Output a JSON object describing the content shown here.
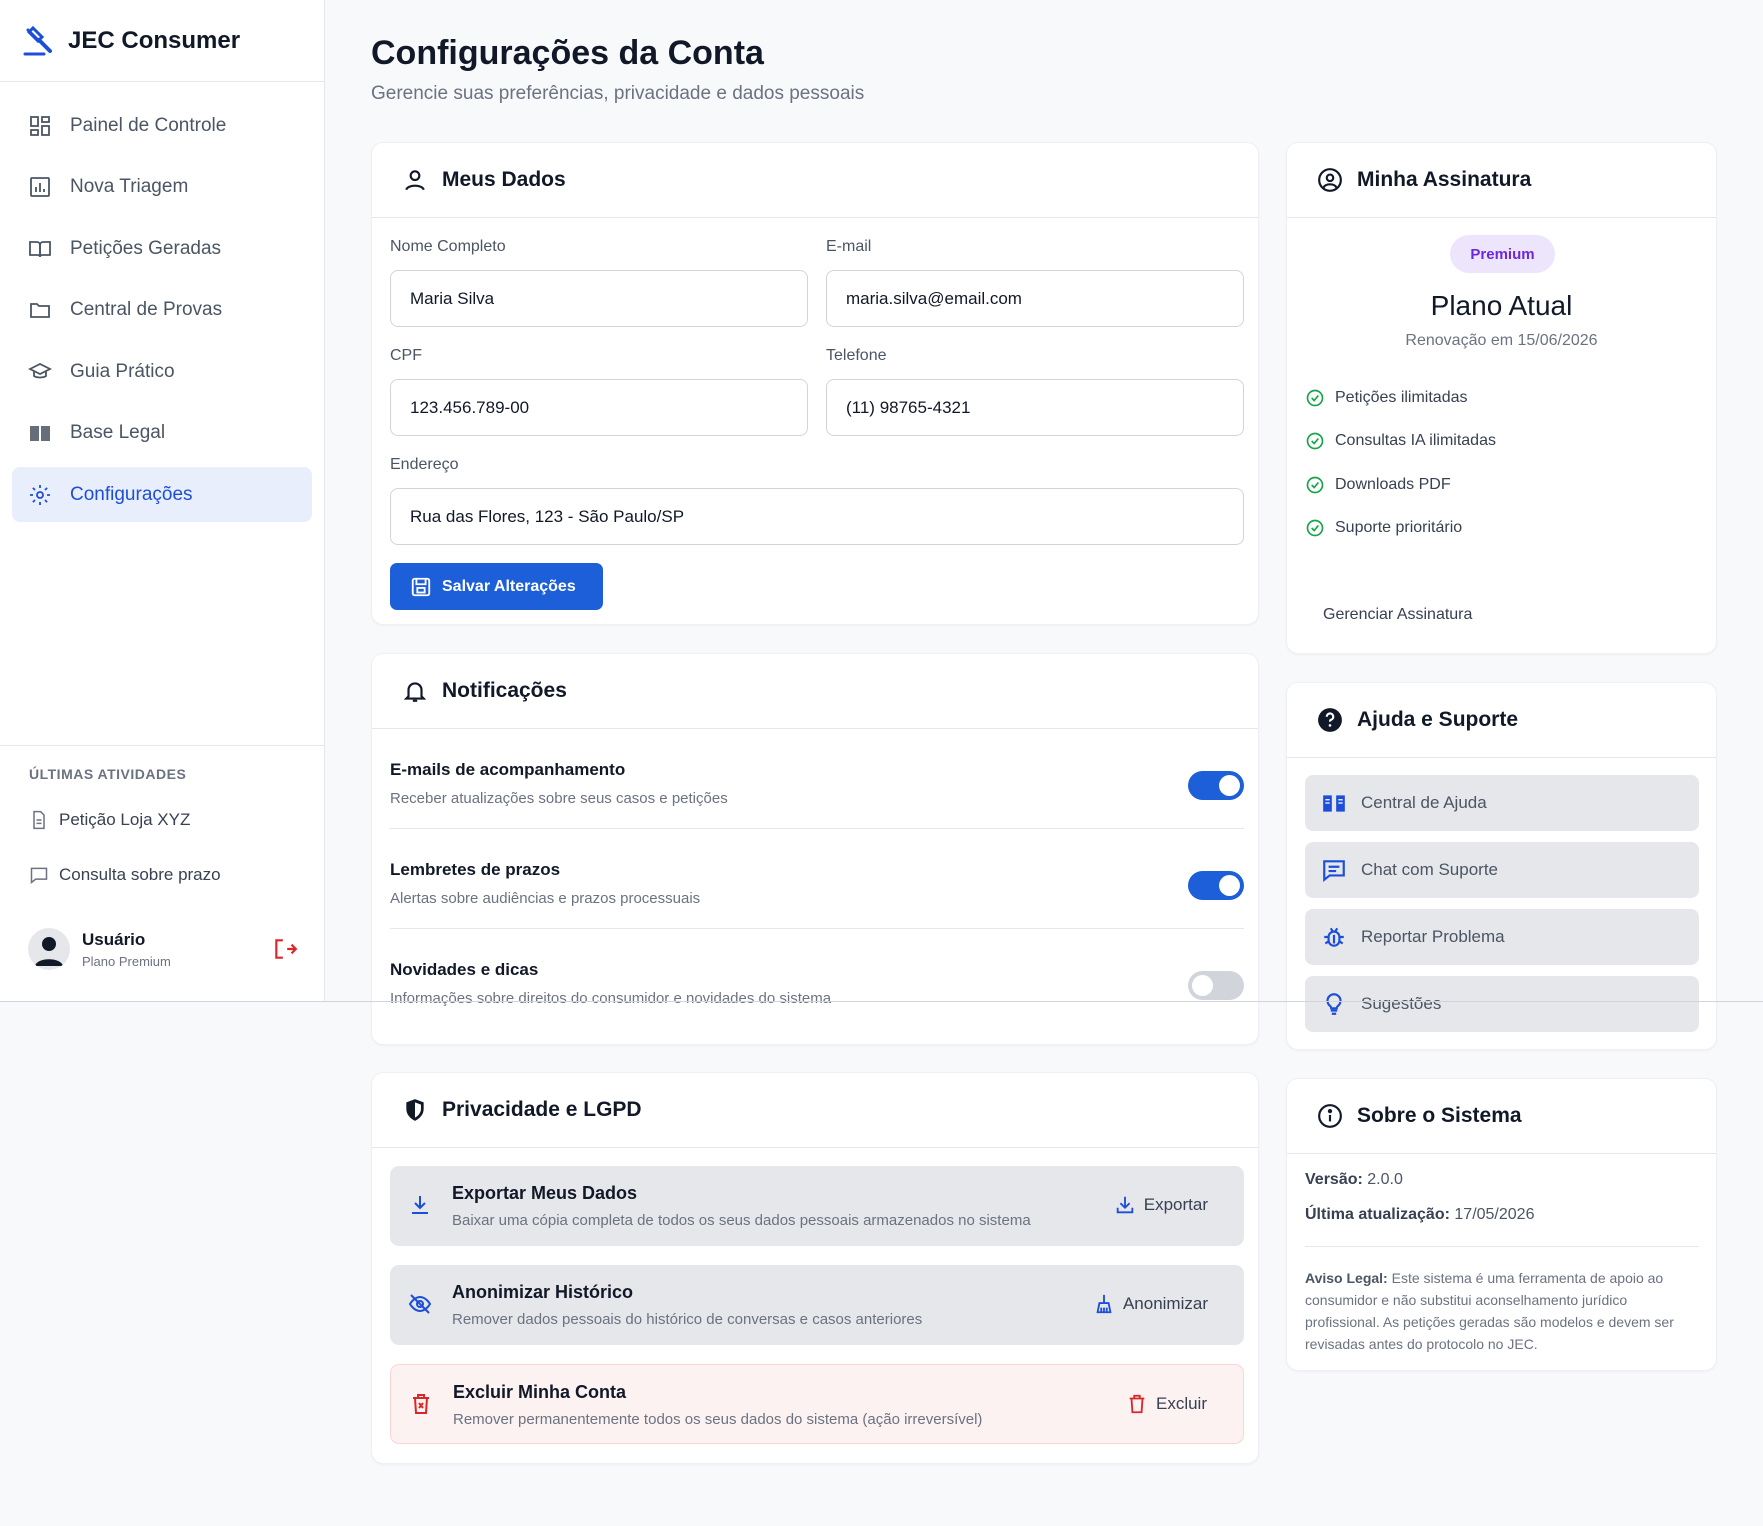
{
  "app": {
    "name": "JEC Consumer"
  },
  "nav": [
    {
      "label": "Painel de Controle",
      "icon": "dashboard-icon"
    },
    {
      "label": "Nova Triagem",
      "icon": "chart-icon"
    },
    {
      "label": "Petições Geradas",
      "icon": "book-open-icon"
    },
    {
      "label": "Central de Provas",
      "icon": "folder-icon"
    },
    {
      "label": "Guia Prático",
      "icon": "graduation-cap-icon"
    },
    {
      "label": "Base Legal",
      "icon": "book-icon"
    },
    {
      "label": "Configurações",
      "icon": "gear-icon",
      "active": true
    }
  ],
  "recent": {
    "title": "ÚLTIMAS ATIVIDADES",
    "items": [
      {
        "label": "Petição Loja XYZ",
        "icon": "document-icon"
      },
      {
        "label": "Consulta sobre prazo",
        "icon": "chat-icon"
      }
    ]
  },
  "user": {
    "name": "Usuário",
    "plan": "Plano Premium"
  },
  "page": {
    "title": "Configurações da Conta",
    "subtitle": "Gerencie suas preferências, privacidade e dados pessoais"
  },
  "profile": {
    "title": "Meus Dados",
    "name_label": "Nome Completo",
    "name_value": "Maria Silva",
    "email_label": "E-mail",
    "email_value": "maria.silva@email.com",
    "cpf_label": "CPF",
    "cpf_value": "123.456.789-00",
    "phone_label": "Telefone",
    "phone_value": "(11) 98765-4321",
    "address_label": "Endereço",
    "address_value": "Rua das Flores, 123 - São Paulo/SP",
    "save_label": "Salvar Alterações"
  },
  "notifications": {
    "title": "Notificações",
    "items": [
      {
        "title": "E-mails de acompanhamento",
        "desc": "Receber atualizações sobre seus casos e petições",
        "enabled": true
      },
      {
        "title": "Lembretes de prazos",
        "desc": "Alertas sobre audiências e prazos processuais",
        "enabled": true
      },
      {
        "title": "Novidades e dicas",
        "desc": "Informações sobre direitos do consumidor e novidades do sistema",
        "enabled": false
      }
    ]
  },
  "privacy": {
    "title": "Privacidade e LGPD",
    "items": [
      {
        "title": "Exportar Meus Dados",
        "desc": "Baixar uma cópia completa de todos os seus dados pessoais armazenados no sistema",
        "action": "Exportar"
      },
      {
        "title": "Anonimizar Histórico",
        "desc": "Remover dados pessoais do histórico de conversas e casos anteriores",
        "action": "Anonimizar"
      },
      {
        "title": "Excluir Minha Conta",
        "desc": "Remover permanentemente todos os seus dados do sistema (ação irreversível)",
        "action": "Excluir"
      }
    ]
  },
  "subscription": {
    "title": "Minha Assinatura",
    "badge": "Premium",
    "plan": "Plano Atual",
    "renewal": "Renovação em 15/06/2026",
    "features": [
      "Petições ilimitadas",
      "Consultas IA ilimitadas",
      "Downloads PDF",
      "Suporte prioritário"
    ],
    "manage_label": "Gerenciar Assinatura"
  },
  "help": {
    "title": "Ajuda e Suporte",
    "items": [
      {
        "label": "Central de Ajuda",
        "icon": "book-open-icon"
      },
      {
        "label": "Chat com Suporte",
        "icon": "chat-icon"
      },
      {
        "label": "Reportar Problema",
        "icon": "bug-icon"
      },
      {
        "label": "Sugestões",
        "icon": "lightbulb-icon"
      }
    ]
  },
  "about": {
    "title": "Sobre o Sistema",
    "version_label": "Versão:",
    "version_value": "2.0.0",
    "updated_label": "Última atualização:",
    "updated_value": "17/05/2026",
    "legal_label": "Aviso Legal:",
    "legal_text": "Este sistema é uma ferramenta de apoio ao consumidor e não substitui aconselhamento jurídico profissional. As petições geradas são modelos e devem ser revisadas antes do protocolo no JEC."
  },
  "colors": {
    "primary": "#1d5fd8",
    "active_bg": "#e8eefc",
    "success": "#16a34a",
    "danger": "#dc2626",
    "badge_bg": "#ede5fb",
    "badge_text": "#6d28d9"
  }
}
